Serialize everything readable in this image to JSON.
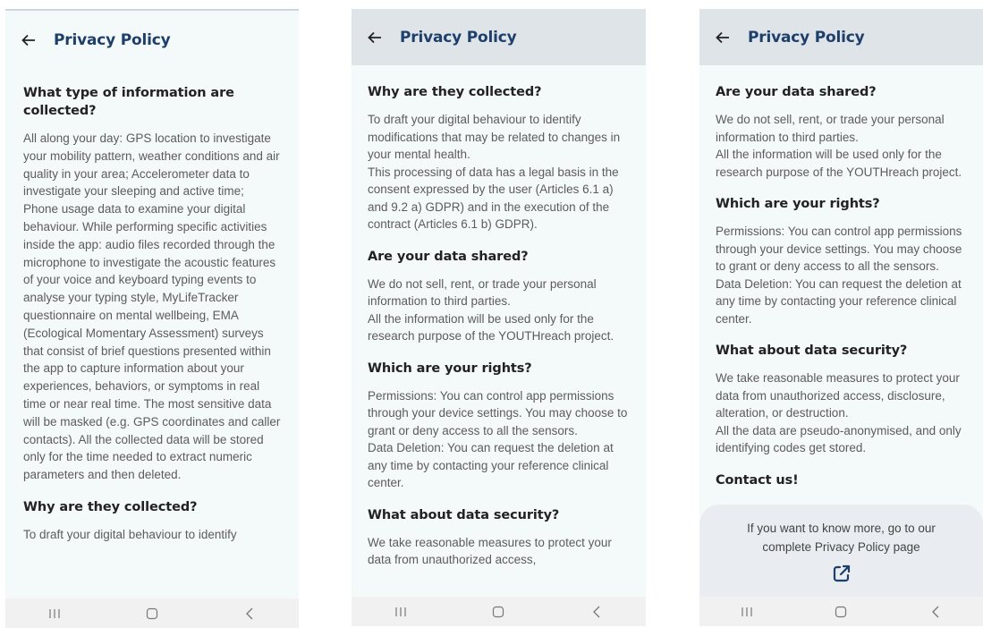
{
  "app_title": "Privacy Policy",
  "icons": {
    "back": "arrow-left-icon",
    "external_link": "external-link-icon",
    "nav_recents": "recent-apps-icon",
    "nav_home": "home-icon",
    "nav_back": "chevron-left-icon"
  },
  "colors": {
    "title": "#1f3f6b",
    "appbar": "#dfe4e9",
    "background": "#f4f9f9",
    "link_icon": "#1f3f6b"
  },
  "screens": [
    {
      "sections": [
        {
          "heading": "What type of information are collected?",
          "body": "All along your day: GPS location to investigate your mobility pattern, weather conditions and air quality in your area; Accelerometer data to investigate your sleeping and active time; Phone usage data to examine your digital behaviour. While performing specific activities inside the app: audio files recorded through the microphone to investigate the acoustic features of your voice and keyboard typing events to analyse your typing style, MyLifeTracker questionnaire on mental wellbeing, EMA (Ecological Momentary Assessment) surveys that consist of brief questions presented within the app to capture information about your experiences, behaviors, or symptoms in real time or near real time. The most sensitive data will be masked (e.g. GPS coordinates and caller contacts). All the collected data will be stored only for the time needed to extract numeric parameters and then deleted."
        },
        {
          "heading": "Why are they collected?",
          "body": "To draft your digital behaviour to identify"
        }
      ]
    },
    {
      "sections": [
        {
          "heading": "Why are they collected?",
          "body": "To draft your digital behaviour to identify modifications that may be related to changes in your mental health.\nThis processing of data has a legal basis in the consent expressed by the user (Articles 6.1 a) and 9.2 a) GDPR) and in the execution of the contract (Articles 6.1 b) GDPR)."
        },
        {
          "heading": "Are your data shared?",
          "body": "We do not sell, rent, or trade your personal information to third parties.\nAll the information will be used only for the research purpose of the YOUTHreach project."
        },
        {
          "heading": "Which are your rights?",
          "body": "Permissions: You can control app permissions through your device settings. You may choose to grant or deny access to all the sensors.\nData Deletion: You can request the deletion at any time by contacting your reference clinical center."
        },
        {
          "heading": "What about data security?",
          "body": "We take reasonable measures to protect your data from unauthorized access,"
        }
      ]
    },
    {
      "sections": [
        {
          "heading": "Are your data shared?",
          "body": "We do not sell, rent, or trade your personal information to third parties.\nAll the information will be used only for the research purpose of the YOUTHreach project."
        },
        {
          "heading": "Which are your rights?",
          "body": "Permissions: You can control app permissions through your device settings. You may choose to grant or deny access to all the sensors.\nData Deletion: You can request the deletion at any time by contacting your reference clinical center."
        },
        {
          "heading": "What about data security?",
          "body": "We take reasonable measures to protect your data from unauthorized access, disclosure, alteration, or destruction.\nAll the data are pseudo-anonymised, and only identifying codes get stored."
        },
        {
          "heading": "Contact us!",
          "body": ""
        }
      ],
      "footer_text": "If you want to know more, go to our complete Privacy Policy page"
    }
  ]
}
